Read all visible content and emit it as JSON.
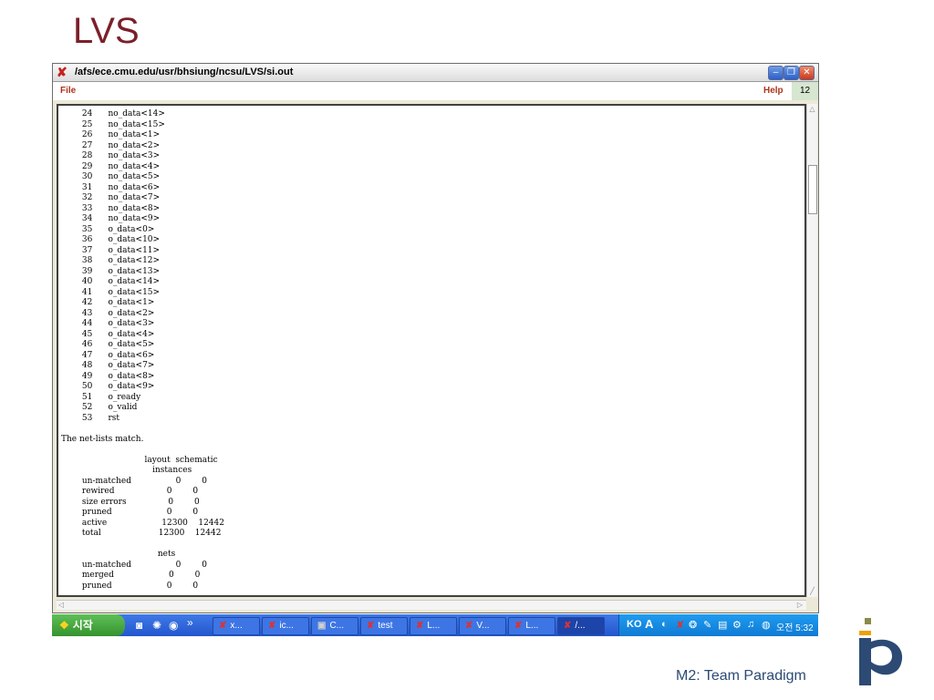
{
  "slide": {
    "title": "LVS",
    "footer": "M2: Team Paradigm"
  },
  "window": {
    "title": "/afs/ece.cmu.edu/usr/bhsiung/ncsu/LVS/si.out",
    "menu": {
      "file": "File",
      "help": "Help",
      "number": "12"
    },
    "output_text": "        24      no_data<14>\n        25      no_data<15>\n        26      no_data<1>\n        27      no_data<2>\n        28      no_data<3>\n        29      no_data<4>\n        30      no_data<5>\n        31      no_data<6>\n        32      no_data<7>\n        33      no_data<8>\n        34      no_data<9>\n        35      o_data<0>\n        36      o_data<10>\n        37      o_data<11>\n        38      o_data<12>\n        39      o_data<13>\n        40      o_data<14>\n        41      o_data<15>\n        42      o_data<1>\n        43      o_data<2>\n        44      o_data<3>\n        45      o_data<4>\n        46      o_data<5>\n        47      o_data<6>\n        48      o_data<7>\n        49      o_data<8>\n        50      o_data<9>\n        51      o_ready\n        52      o_valid\n        53      rst\n\nThe net-lists match.\n\n                                layout  schematic\n                                   instances\n        un-matched                 0        0\n        rewired                    0        0\n        size errors                0        0\n        pruned                     0        0\n        active                     12300    12442\n        total                      12300    12442\n\n                                     nets\n        un-matched                 0        0\n        merged                     0        0\n        pruned                     0        0"
  },
  "taskbar": {
    "start_label": "시작",
    "chevron": "»",
    "tasks": [
      {
        "label": "x..."
      },
      {
        "label": "ic..."
      },
      {
        "label": "C..."
      },
      {
        "label": "test"
      },
      {
        "label": "L..."
      },
      {
        "label": "V..."
      },
      {
        "label": "L..."
      },
      {
        "label": "/..."
      }
    ],
    "tray": {
      "lang": "KO",
      "ime": "A",
      "clock": "오전 5:32"
    }
  }
}
